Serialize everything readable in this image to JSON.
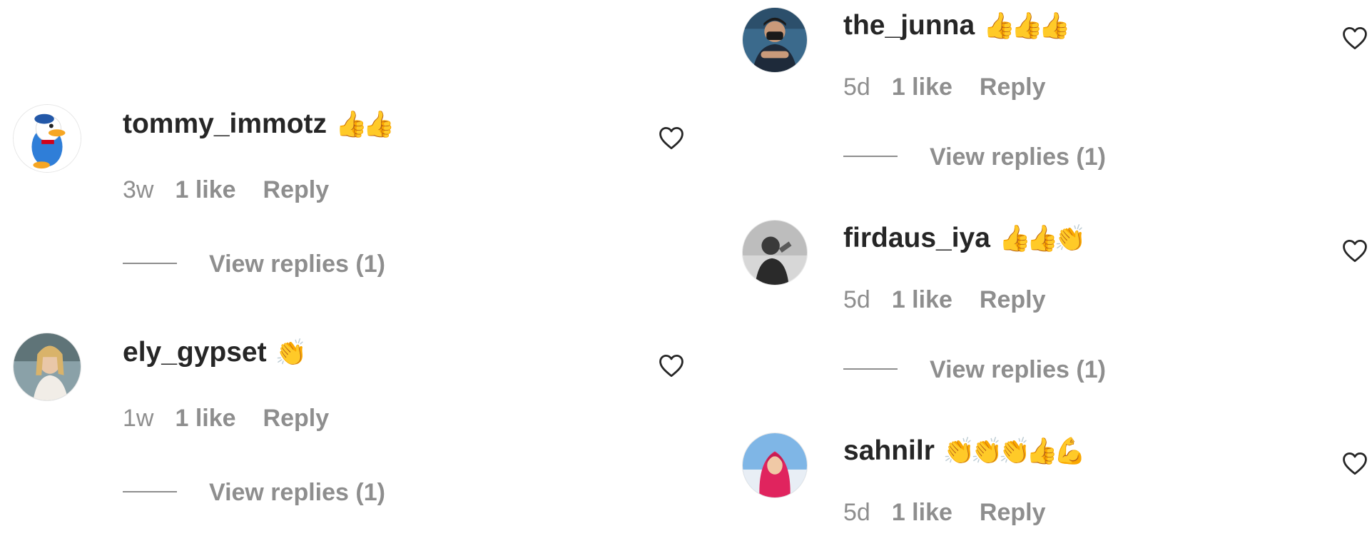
{
  "comments": [
    {
      "username": "tommy_immotz",
      "emoji": "👍👍",
      "time": "3w",
      "likes": "1 like",
      "reply": "Reply",
      "view_replies": "View replies (1)"
    },
    {
      "username": "ely_gypset",
      "emoji": "👏",
      "time": "1w",
      "likes": "1 like",
      "reply": "Reply",
      "view_replies": "View replies (1)"
    },
    {
      "username": "the_junna",
      "emoji": "👍👍👍",
      "time": "5d",
      "likes": "1 like",
      "reply": "Reply",
      "view_replies": "View replies (1)"
    },
    {
      "username": "firdaus_iya",
      "emoji": "👍👍👏",
      "time": "5d",
      "likes": "1 like",
      "reply": "Reply",
      "view_replies": "View replies (1)"
    },
    {
      "username": "sahnilr",
      "emoji": "👏👏👏👍💪",
      "time": "5d",
      "likes": "1 like",
      "reply": "Reply"
    }
  ],
  "icons": {
    "like": "heart-outline-icon"
  },
  "colors": {
    "text_primary": "#262626",
    "text_secondary": "#8e8e8e",
    "emoji_yellow": "#f2b51f"
  }
}
